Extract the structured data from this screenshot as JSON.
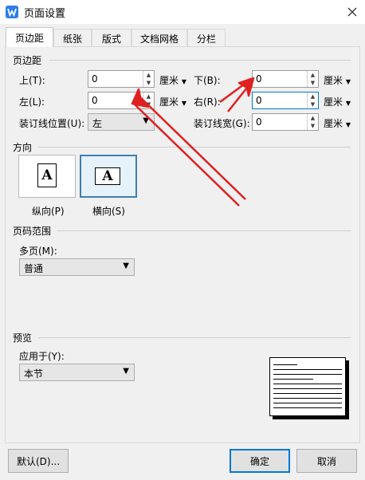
{
  "window": {
    "title": "页面设置"
  },
  "tabs": [
    {
      "label": "页边距"
    },
    {
      "label": "纸张"
    },
    {
      "label": "版式"
    },
    {
      "label": "文档网格"
    },
    {
      "label": "分栏"
    }
  ],
  "margins": {
    "section_title": "页边距",
    "top_label": "上(T):",
    "top_value": "0",
    "bottom_label": "下(B):",
    "bottom_value": "0",
    "left_label": "左(L):",
    "left_value": "0",
    "right_label": "右(R):",
    "right_value": "0",
    "gutter_pos_label": "装订线位置(U):",
    "gutter_pos_value": "左",
    "gutter_width_label": "装订线宽(G):",
    "gutter_width_value": "0",
    "unit": "厘米"
  },
  "orientation": {
    "section_title": "方向",
    "glyph": "A",
    "portrait_label": "纵向(P)",
    "landscape_label": "横向(S)"
  },
  "page_range": {
    "section_title": "页码范围",
    "multi_label": "多页(M):",
    "multi_value": "普通"
  },
  "preview": {
    "section_title": "预览",
    "apply_label": "应用于(Y):",
    "apply_value": "本节"
  },
  "buttons": {
    "default": "默认(D)...",
    "ok": "确定",
    "cancel": "取消"
  },
  "colors": {
    "annotation_arrow": "#e02020",
    "selected_border": "#3c7fb1",
    "ok_border": "#0078d7"
  }
}
